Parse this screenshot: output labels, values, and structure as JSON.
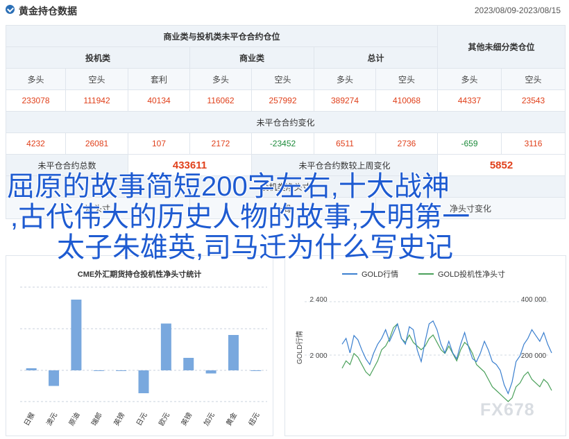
{
  "header": {
    "title": "黄金持仓数据",
    "date_range": "2023/08/09-2023/08/15"
  },
  "table": {
    "group_a_title": "商业类与投机类未平仓合约仓位",
    "group_b_title": "其他未细分类仓位",
    "cat_spec": "投机类",
    "cat_comm": "商业类",
    "cat_total": "总计",
    "col_long": "多头",
    "col_short": "空头",
    "col_spread": "套利",
    "values": [
      "233078",
      "111942",
      "40134",
      "116062",
      "257992",
      "389274",
      "410068",
      "44337",
      "23543"
    ],
    "change_title": "未平仓合约变化",
    "changes": [
      "4232",
      "26081",
      "107",
      "2172",
      "-23452",
      "6511",
      "2736",
      "-659",
      "3116"
    ],
    "oi_total_label": "未平仓合约总数",
    "oi_total_value": "433611",
    "oi_change_label": "未平仓合约数较上周变化",
    "oi_change_value": "5852",
    "partial_row_label": "投机类净头寸",
    "partial_row_col2": "一周",
    "partial_row_col3": "变化",
    "partial_row_sub1": "净头寸",
    "partial_row_sub2": "净头寸变化"
  },
  "overlay": {
    "line1": "屈原的故事简短200字左右,十大战神",
    "line2": ",古代伟大的历史人物的故事,大明第一",
    "line3": "太子朱雄英,司马迁为什么写史记"
  },
  "watermark": "FX678",
  "chart_data": [
    {
      "type": "bar",
      "title": "CME外汇期货持仓投机性净头寸统计",
      "categories": [
        "日猴",
        "澳元",
        "原油",
        "瑞郎",
        "英镑",
        "日元",
        "欧元",
        "英镑",
        "加元",
        "黄金",
        "纽元"
      ],
      "values": [
        2,
        -15,
        68,
        0,
        0,
        -22,
        45,
        12,
        -3,
        34,
        0
      ],
      "ylim": [
        -30,
        80
      ],
      "grid": true,
      "colors": {
        "bar": "#79a8de"
      }
    },
    {
      "type": "line",
      "title": "",
      "legend_position": "top",
      "y_left_label": "GOLD行情",
      "y_left_ticks": [
        "2 400",
        "2 000"
      ],
      "y_right_ticks": [
        "400 000",
        "200 000"
      ],
      "series": [
        {
          "name": "GOLD行情",
          "color": "#3a7fcf",
          "values": [
            1990,
            2010,
            1960,
            2020,
            2005,
            1970,
            1940,
            1920,
            1960,
            1990,
            2010,
            2040,
            2000,
            2030,
            2060,
            2010,
            1990,
            2050,
            2040,
            1970,
            1930,
            2000,
            2060,
            2070,
            2040,
            1990,
            1960,
            2000,
            1960,
            1940,
            1990,
            2030,
            1980,
            1940,
            1930,
            1960,
            2000,
            1970,
            1930,
            1920,
            1900,
            1850,
            1820,
            1860,
            1930,
            1950,
            1990,
            2010,
            2040,
            2020,
            2000,
            2030,
            1990,
            1960
          ]
        },
        {
          "name": "GOLD投机性净头寸",
          "color": "#4aa05a",
          "values": [
            240000,
            260000,
            250000,
            280000,
            270000,
            250000,
            230000,
            220000,
            240000,
            260000,
            290000,
            300000,
            320000,
            350000,
            360000,
            320000,
            310000,
            330000,
            310000,
            300000,
            290000,
            300000,
            320000,
            330000,
            310000,
            290000,
            280000,
            300000,
            280000,
            260000,
            290000,
            310000,
            300000,
            280000,
            250000,
            240000,
            230000,
            210000,
            190000,
            180000,
            170000,
            160000,
            150000,
            160000,
            190000,
            200000,
            220000,
            230000,
            210000,
            200000,
            190000,
            210000,
            200000,
            180000
          ]
        }
      ]
    }
  ]
}
